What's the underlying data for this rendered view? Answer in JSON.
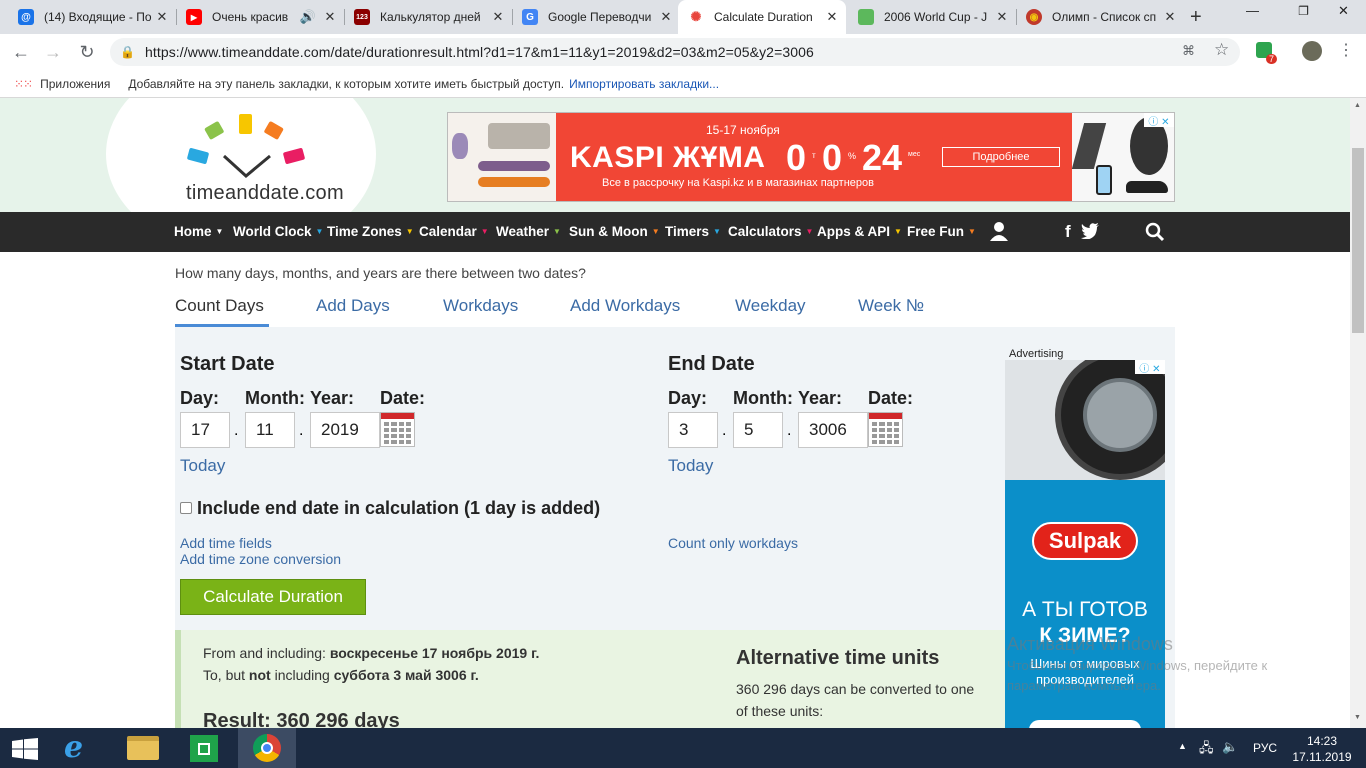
{
  "browser": {
    "tabs": [
      {
        "title": "(14) Входящие - По",
        "favicon_color": "#1a73e8",
        "favicon_glyph": "@"
      },
      {
        "title": "Очень красив",
        "favicon_color": "#ff0000",
        "favicon_glyph": "▶"
      },
      {
        "title": "Калькулятор дней",
        "favicon_color": "#8b0000",
        "favicon_glyph": "123"
      },
      {
        "title": "Google Переводчи",
        "favicon_color": "#4285f4",
        "favicon_glyph": "G"
      },
      {
        "title": "Calculate Duration",
        "favicon_color": "#ffffff",
        "favicon_glyph": "✺"
      },
      {
        "title": "2006 World Cup - J",
        "favicon_color": "#5cb85c",
        "favicon_glyph": ""
      },
      {
        "title": "Олимп - Список сп",
        "favicon_color": "#c0392b",
        "favicon_glyph": "◉"
      }
    ],
    "url": "https://www.timeanddate.com/date/durationresult.html?d1=17&m1=11&y1=2019&d2=03&m2=05&y2=3006",
    "extension_badge": "7",
    "bookmarks": {
      "apps_label": "Приложения",
      "hint": "Добавляйте на эту панель закладки, к которым хотите иметь быстрый доступ.",
      "import_link": "Импортировать закладки..."
    }
  },
  "site": {
    "logo_text": "timeanddate.com",
    "ad": {
      "date": "15-17 ноября",
      "headline": "KASPI ЖҰМА",
      "offer_a": "0",
      "offer_b": "0",
      "offer_c": "24",
      "offer_unit_a": "т",
      "offer_unit_b": "%",
      "offer_unit_c": "мес",
      "subtext": "Все в рассрочку на Kaspi.kz и в магазинах партнеров",
      "button": "Подробнее"
    },
    "nav": [
      {
        "label": "Home",
        "caret": "▼"
      },
      {
        "label": "World Clock",
        "caret": "▼"
      },
      {
        "label": "Time Zones",
        "caret": "▼"
      },
      {
        "label": "Calendar",
        "caret": "▼"
      },
      {
        "label": "Weather",
        "caret": "▼"
      },
      {
        "label": "Sun & Moon",
        "caret": "▼"
      },
      {
        "label": "Timers",
        "caret": "▼"
      },
      {
        "label": "Calculators",
        "caret": "▼"
      },
      {
        "label": "Apps & API",
        "caret": "▼"
      },
      {
        "label": "Free Fun",
        "caret": "▼"
      }
    ],
    "question": "How many days, months, and years are there between two dates?",
    "subtabs": [
      "Count Days",
      "Add Days",
      "Workdays",
      "Add Workdays",
      "Weekday",
      "Week №"
    ],
    "start": {
      "heading": "Start Date",
      "day_label": "Day:",
      "month_label": "Month:",
      "year_label": "Year:",
      "date_label": "Date:",
      "day": "17",
      "month": "11",
      "year": "2019",
      "today": "Today"
    },
    "end": {
      "heading": "End Date",
      "day_label": "Day:",
      "month_label": "Month:",
      "year_label": "Year:",
      "date_label": "Date:",
      "day": "3",
      "month": "5",
      "year": "3006",
      "today": "Today"
    },
    "separator": ".",
    "include_end": "Include end date in calculation (1 day is added)",
    "add_time": "Add time fields",
    "add_tz": "Add time zone conversion",
    "workdays_only": "Count only workdays",
    "calc_button": "Calculate Duration",
    "result": {
      "from_prefix": "From and including: ",
      "from_date": "воскресенье 17 ноябрь 2019 г.",
      "to_prefix": "To, but ",
      "to_not": "not",
      "to_mid": " including ",
      "to_date": "суббота 3 май 3006 г.",
      "result_line": "Result: 360 296 days",
      "alt_heading": "Alternative time units",
      "alt_text_1": "360 296 days can be converted to one",
      "alt_text_2": "of these units:"
    },
    "side_ad": {
      "label": "Advertising",
      "brand": "Sulpak",
      "headline_1": "А ТЫ ГОТОВ",
      "headline_2": "К ЗИМЕ?",
      "sub_1": "Шины от мировых",
      "sub_2": "производителей"
    }
  },
  "os": {
    "watermark_title": "Активация Windows",
    "watermark_1": "Чтобы активировать Windows, перейдите к",
    "watermark_2": "параметрам компьютера.",
    "lang": "РУС",
    "time": "14:23",
    "date": "17.11.2019"
  }
}
